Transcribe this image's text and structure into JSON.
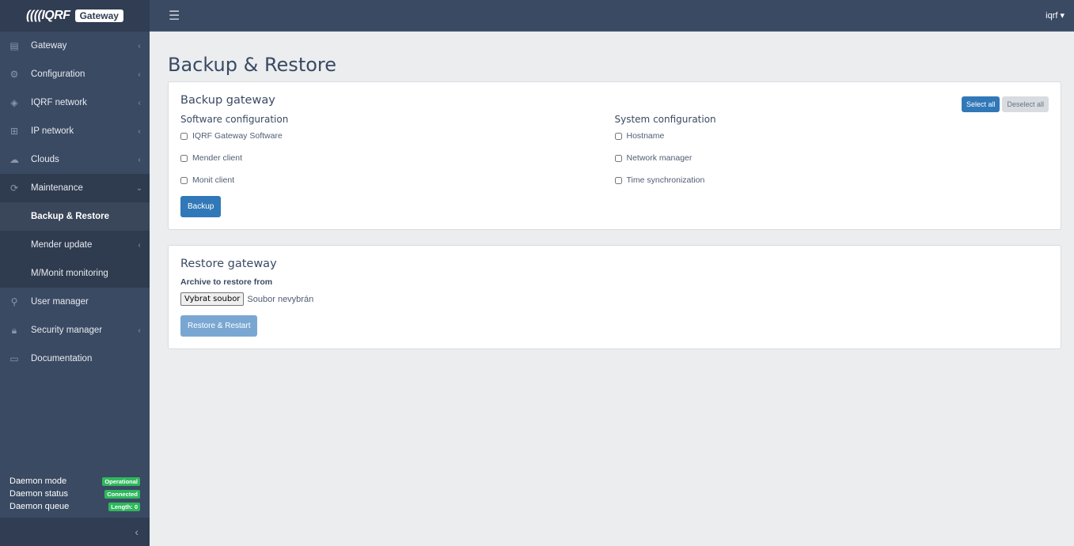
{
  "brand": {
    "logo": "IQRF",
    "badge": "Gateway"
  },
  "header": {
    "user": "iqrf",
    "user_caret": "▾"
  },
  "sidebar": {
    "items": [
      {
        "label": "Gateway",
        "icon": "server-icon",
        "glyph": "▤",
        "chevron": "‹"
      },
      {
        "label": "Configuration",
        "icon": "gear-icon",
        "glyph": "⚙",
        "chevron": "‹"
      },
      {
        "label": "IQRF network",
        "icon": "wireless-icon",
        "glyph": "◈",
        "chevron": "‹"
      },
      {
        "label": "IP network",
        "icon": "network-icon",
        "glyph": "⊞",
        "chevron": "‹"
      },
      {
        "label": "Clouds",
        "icon": "cloud-icon",
        "glyph": "☁",
        "chevron": "‹"
      },
      {
        "label": "Maintenance",
        "icon": "refresh-icon",
        "glyph": "⟳",
        "chevron": "⌄"
      }
    ],
    "sub_items": [
      {
        "label": "Backup & Restore",
        "chevron": ""
      },
      {
        "label": "Mender update",
        "chevron": "‹"
      },
      {
        "label": "M/Monit monitoring",
        "chevron": ""
      }
    ],
    "items_after": [
      {
        "label": "User manager",
        "icon": "user-icon",
        "glyph": "⚲",
        "chevron": ""
      },
      {
        "label": "Security manager",
        "icon": "lock-icon",
        "glyph": "🔒︎",
        "chevron": "‹"
      },
      {
        "label": "Documentation",
        "icon": "book-icon",
        "glyph": "▭",
        "chevron": ""
      }
    ],
    "status": [
      {
        "label": "Daemon mode",
        "value": "Operational"
      },
      {
        "label": "Daemon status",
        "value": "Connected"
      },
      {
        "label": "Daemon queue",
        "value": "Length: 0"
      }
    ],
    "collapse": "‹"
  },
  "page": {
    "title": "Backup & Restore"
  },
  "backup": {
    "title": "Backup gateway",
    "select_all": "Select all",
    "deselect_all": "Deselect all",
    "software": {
      "title": "Software configuration",
      "options": [
        {
          "label": "IQRF Gateway Software",
          "checked": false
        },
        {
          "label": "Mender client",
          "checked": false
        },
        {
          "label": "Monit client",
          "checked": false
        }
      ]
    },
    "system": {
      "title": "System configuration",
      "options": [
        {
          "label": "Hostname",
          "checked": false
        },
        {
          "label": "Network manager",
          "checked": false
        },
        {
          "label": "Time synchronization",
          "checked": false
        }
      ]
    },
    "button": "Backup"
  },
  "restore": {
    "title": "Restore gateway",
    "archive_label": "Archive to restore from",
    "file_button": "Vybrat soubor",
    "file_status": "Soubor nevybrán",
    "button": "Restore & Restart"
  },
  "colors": {
    "primary": "#3178b8",
    "success": "#2eb85c",
    "sidebar": "#3a4a63"
  }
}
